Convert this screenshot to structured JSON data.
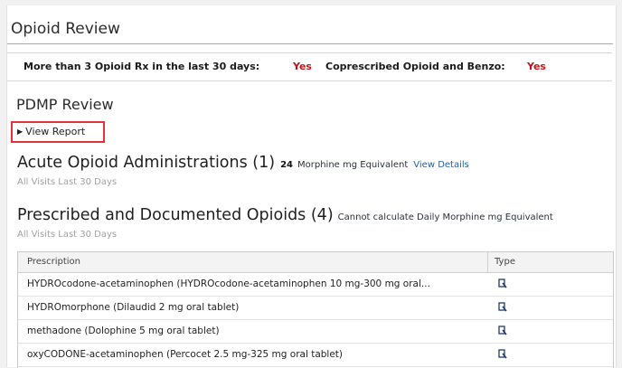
{
  "header": {
    "title": "Opioid Review"
  },
  "alerts": {
    "rx_label": "More than 3 Opioid Rx in the last 30 days:",
    "rx_value": "Yes",
    "coprescribed_label": "Coprescribed Opioid and Benzo:",
    "coprescribed_value": "Yes"
  },
  "pdmp": {
    "title": "PDMP Review",
    "view_report_label": "View Report"
  },
  "acute": {
    "title": "Acute Opioid Administrations (1)",
    "mme_value": "24",
    "mme_label": "Morphine mg Equivalent",
    "view_details": "View Details",
    "subtitle": "All Visits Last 30 Days"
  },
  "prescribed": {
    "title": "Prescribed and Documented Opioids (4)",
    "note": "Cannot calculate Daily Morphine mg Equivalent",
    "subtitle": "All Visits Last 30 Days"
  },
  "table": {
    "columns": [
      "Prescription",
      "Type"
    ],
    "rows": [
      {
        "prescription": "HYDROcodone-acetaminophen (HYDROcodone-acetaminophen 10 mg-300 mg oral...",
        "type_icon": "prescription-pad-icon"
      },
      {
        "prescription": "HYDROmorphone (Dilaudid 2 mg oral tablet)",
        "type_icon": "prescription-pad-icon"
      },
      {
        "prescription": "methadone (Dolophine 5 mg oral tablet)",
        "type_icon": "prescription-pad-icon"
      },
      {
        "prescription": "oxyCODONE-acetaminophen (Percocet 2.5 mg-325 mg oral tablet)",
        "type_icon": "prescription-pad-icon"
      }
    ]
  },
  "colors": {
    "alert_red": "#c0131b",
    "link_blue": "#1f5fa7",
    "highlight_red": "#e2313b"
  }
}
